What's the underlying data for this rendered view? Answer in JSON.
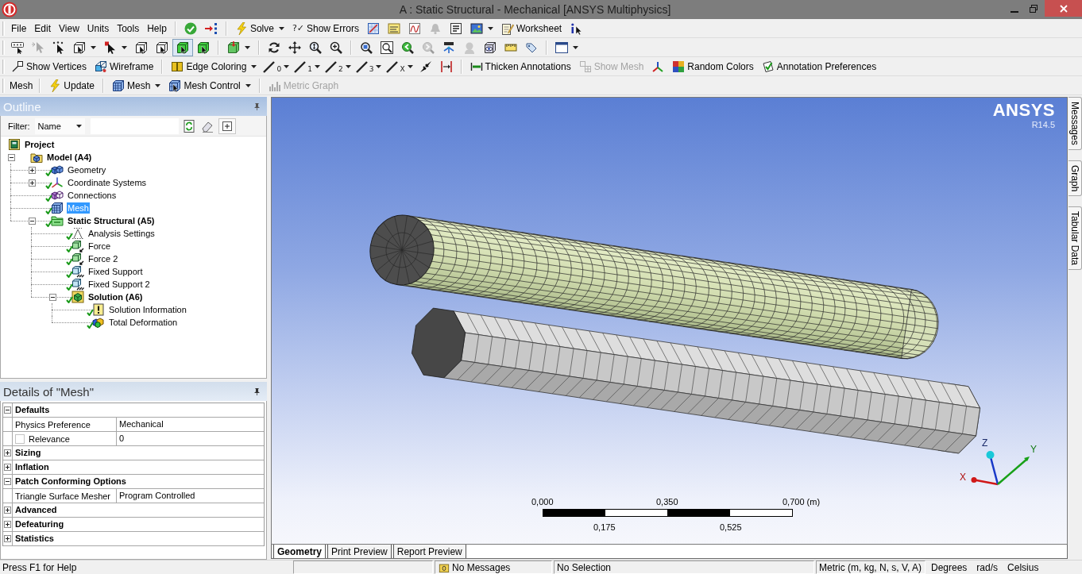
{
  "window": {
    "title": "A : Static Structural - Mechanical [ANSYS Multiphysics]"
  },
  "toolbars": [
    {
      "menus": [
        "File",
        "Edit",
        "View",
        "Units",
        "Tools",
        "Help"
      ],
      "groups": [
        [
          {
            "disabled": false,
            "dropdown": false
          },
          {
            "disabled": false,
            "dropdown": false
          }
        ],
        [
          {
            "label": "Solve",
            "disabled": false,
            "dropdown": true
          },
          {
            "glyph": "?✓",
            "label": "Show Errors",
            "disabled": false,
            "dropdown": false
          },
          {
            "disabled": false,
            "dropdown": false
          },
          {
            "disabled": false,
            "dropdown": false
          },
          {
            "disabled": false,
            "dropdown": false
          },
          {
            "disabled": true,
            "dropdown": false
          },
          {
            "disabled": false,
            "dropdown": false
          },
          {
            "disabled": false,
            "dropdown": true
          },
          {
            "label": "Worksheet",
            "disabled": false,
            "dropdown": false
          },
          {
            "disabled": false,
            "dropdown": false
          }
        ]
      ]
    },
    {
      "groups": [
        [
          {
            "disabled": false,
            "dropdown": false,
            "pressed": false
          },
          {
            "disabled": true,
            "dropdown": false,
            "pressed": false
          },
          {
            "disabled": false,
            "dropdown": false,
            "pressed": false
          },
          {
            "disabled": false,
            "dropdown": true,
            "pressed": false
          },
          {
            "disabled": false,
            "dropdown": true,
            "pressed": false
          },
          {
            "disabled": false,
            "dropdown": false,
            "pressed": false
          },
          {
            "disabled": false,
            "dropdown": false,
            "pressed": false
          },
          {
            "disabled": false,
            "dropdown": false,
            "pressed": true
          },
          {
            "disabled": false,
            "dropdown": false,
            "pressed": false
          }
        ],
        [
          {
            "disabled": false,
            "dropdown": true,
            "pressed": false
          }
        ],
        [
          {
            "disabled": false,
            "dropdown": false,
            "pressed": false
          },
          {
            "disabled": false,
            "dropdown": false,
            "pressed": false
          },
          {
            "disabled": false,
            "dropdown": false,
            "pressed": false
          },
          {
            "disabled": false,
            "dropdown": false,
            "pressed": false
          }
        ],
        [
          {
            "disabled": false,
            "dropdown": false,
            "pressed": false
          },
          {
            "disabled": false,
            "dropdown": false,
            "pressed": false
          },
          {
            "disabled": false,
            "dropdown": false,
            "pressed": false
          },
          {
            "disabled": true,
            "dropdown": false,
            "pressed": false
          },
          {
            "disabled": false,
            "dropdown": false,
            "pressed": false
          },
          {
            "disabled": true,
            "dropdown": false,
            "pressed": false
          },
          {
            "disabled": false,
            "dropdown": false,
            "pressed": false
          },
          {
            "disabled": false,
            "dropdown": false,
            "pressed": false
          },
          {
            "disabled": false,
            "dropdown": false,
            "pressed": false
          }
        ],
        [
          {
            "disabled": false,
            "dropdown": true,
            "pressed": false
          }
        ]
      ]
    },
    {
      "groups": [
        [
          {
            "label": "Show Vertices",
            "disabled": false,
            "dropdown": false
          },
          {
            "label": "Wireframe",
            "disabled": false,
            "dropdown": false
          }
        ],
        [
          {
            "label": "Edge Coloring",
            "disabled": false,
            "dropdown": true
          },
          {
            "glyph": "0",
            "disabled": false,
            "dropdown": true
          },
          {
            "glyph": "1",
            "disabled": false,
            "dropdown": true
          },
          {
            "glyph": "2",
            "disabled": false,
            "dropdown": true
          },
          {
            "glyph": "3",
            "disabled": false,
            "dropdown": true
          },
          {
            "glyph": "X",
            "disabled": false,
            "dropdown": true
          },
          {
            "disabled": false,
            "dropdown": false
          },
          {
            "disabled": false,
            "dropdown": false
          }
        ],
        [
          {
            "label": "Thicken Annotations",
            "disabled": false,
            "dropdown": false
          },
          {
            "label": "Show Mesh",
            "disabled": true,
            "dropdown": false
          },
          {
            "disabled": false,
            "dropdown": false
          },
          {
            "label": "Random Colors",
            "disabled": false,
            "dropdown": false
          },
          {
            "label": "Annotation Preferences",
            "disabled": false,
            "dropdown": false
          }
        ]
      ]
    },
    {
      "caption": "Mesh",
      "groups": [
        [
          {
            "label": "Update",
            "disabled": false,
            "dropdown": false
          }
        ],
        [
          {
            "label": "Mesh",
            "disabled": false,
            "dropdown": true
          },
          {
            "label": "Mesh Control",
            "disabled": false,
            "dropdown": true
          }
        ],
        [
          {
            "label": "Metric Graph",
            "disabled": true,
            "dropdown": false
          }
        ]
      ]
    }
  ],
  "outline": {
    "title": "Outline",
    "filter": {
      "label": "Filter:",
      "value": "Name"
    },
    "tree": [
      {
        "label": "Project",
        "kind": "heading",
        "ok": false,
        "selected": false,
        "children": [
          {
            "label": "Model (A4)",
            "kind": "heading",
            "ok": false,
            "selected": false,
            "expanded": true,
            "children": [
              {
                "label": "Geometry",
                "kind": "item",
                "ok": true,
                "selected": false,
                "expanded": false
              },
              {
                "label": "Coordinate Systems",
                "kind": "item",
                "ok": true,
                "selected": false,
                "expanded": false
              },
              {
                "label": "Connections",
                "kind": "item",
                "ok": true,
                "selected": false
              },
              {
                "label": "Mesh",
                "kind": "item",
                "ok": true,
                "selected": true
              },
              {
                "label": "Static Structural (A5)",
                "kind": "heading",
                "ok": true,
                "selected": false,
                "expanded": true,
                "children": [
                  {
                    "label": "Analysis Settings",
                    "kind": "item",
                    "ok": true,
                    "selected": false
                  },
                  {
                    "label": "Force",
                    "kind": "item",
                    "ok": true,
                    "selected": false
                  },
                  {
                    "label": "Force 2",
                    "kind": "item",
                    "ok": true,
                    "selected": false
                  },
                  {
                    "label": "Fixed Support",
                    "kind": "item",
                    "ok": true,
                    "selected": false
                  },
                  {
                    "label": "Fixed Support 2",
                    "kind": "item",
                    "ok": true,
                    "selected": false
                  },
                  {
                    "label": "Solution (A6)",
                    "kind": "heading",
                    "ok": true,
                    "selected": false,
                    "expanded": true,
                    "children": [
                      {
                        "label": "Solution Information",
                        "kind": "item",
                        "ok": true,
                        "selected": false
                      },
                      {
                        "label": "Total Deformation",
                        "kind": "item",
                        "ok": true,
                        "selected": false
                      }
                    ]
                  }
                ]
              }
            ]
          }
        ]
      }
    ]
  },
  "details": {
    "title": "Details of \"Mesh\"",
    "groups": [
      {
        "label": "Defaults",
        "expanded": true,
        "rows": [
          {
            "kind": "plain",
            "property": "Physics Preference",
            "value": "Mechanical"
          },
          {
            "kind": "parameter",
            "checked": false,
            "property": "Relevance",
            "value": "0"
          }
        ]
      },
      {
        "label": "Sizing",
        "expanded": false
      },
      {
        "label": "Inflation",
        "expanded": false
      },
      {
        "label": "Patch Conforming Options",
        "expanded": true,
        "rows": [
          {
            "kind": "plain",
            "property": "Triangle Surface Mesher",
            "value": "Program Controlled"
          }
        ]
      },
      {
        "label": "Advanced",
        "expanded": false
      },
      {
        "label": "Defeaturing",
        "expanded": false
      },
      {
        "label": "Statistics",
        "expanded": false
      }
    ]
  },
  "viewport": {
    "logo": "ANSYS",
    "version": "R14.5",
    "triad": [
      "Z",
      "Y",
      "X"
    ],
    "scale_bar": {
      "upper": [
        "0,000",
        "0,350",
        "0,700 (m)"
      ],
      "lower": [
        "0,175",
        "0,525"
      ]
    },
    "tabs": [
      {
        "label": "Geometry",
        "selected": true
      },
      {
        "label": "Print Preview",
        "selected": false
      },
      {
        "label": "Report Preview",
        "selected": false
      }
    ]
  },
  "side_tabs": [
    {
      "label": "Messages",
      "selected": false
    },
    {
      "label": "Graph",
      "selected": false
    },
    {
      "label": "Tabular Data",
      "selected": false
    }
  ],
  "status_bar": {
    "help": "Press F1 for Help",
    "messages": "No Messages",
    "selection": "No Selection",
    "units": "Metric (m, kg, N, s, V, A)",
    "angle_unit": "Degrees",
    "rate_unit": "rad/s",
    "temperature_unit": "Celsius"
  }
}
